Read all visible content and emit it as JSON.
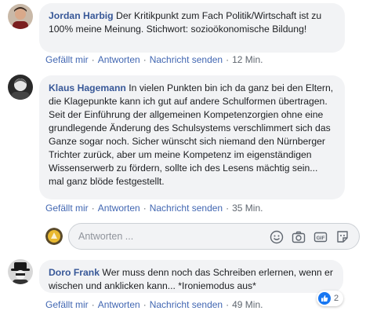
{
  "comments": [
    {
      "author": "Jordan Harbig",
      "text": "Der Kritikpunkt zum Fach Politik/Wirtschaft ist zu 100% meine Meinung. Stichwort: sozioökonomische Bildung!",
      "like": "Gefällt mir",
      "reply": "Antworten",
      "message": "Nachricht senden",
      "time": "12 Min."
    },
    {
      "author": "Klaus Hagemann",
      "text": "In vielen Punkten bin ich da ganz bei den Eltern, die Klagepunkte kann ich gut auf andere Schulformen übertragen. Seit der Einführung der allgemeinen Kompetenzorgien ohne eine grundlegende Änderung des Schulsystems verschlimmert sich das Ganze sogar noch. Sicher wünscht sich niemand den Nürnberger Trichter zurück, aber um meine Kompetenz im eigenständigen Wissenserwerb zu fördern, sollte ich des Lesens mächtig sein... mal ganz blöde festgestellt.",
      "like": "Gefällt mir",
      "reply": "Antworten",
      "message": "Nachricht senden",
      "time": "35 Min."
    },
    {
      "author": "Doro Frank",
      "text": "Wer muss denn noch das Schreiben erlernen, wenn er wischen und anklicken kann... *Ironiemodus aus*",
      "like": "Gefällt mir",
      "reply": "Antworten",
      "message": "Nachricht senden",
      "time": "49 Min.",
      "reaction_count": "2"
    }
  ],
  "reply_box": {
    "placeholder": "Antworten ..."
  },
  "icons": [
    "emoji-icon",
    "camera-icon",
    "gif-icon",
    "sticker-icon",
    "like-icon"
  ],
  "colors": {
    "author": "#385898",
    "link": "#4267b2",
    "bubble": "#f2f3f5",
    "meta": "#606770",
    "like": "#1877f2"
  }
}
